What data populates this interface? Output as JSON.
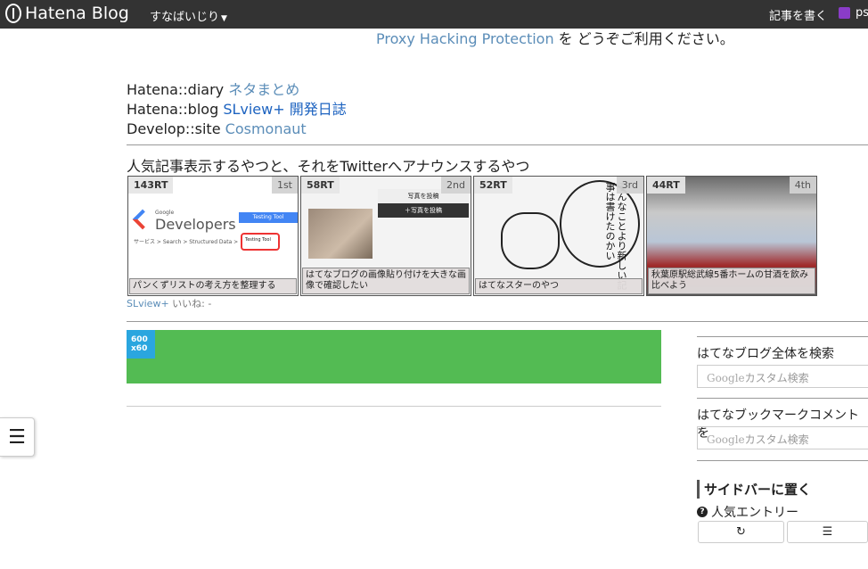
{
  "topbar": {
    "brand": "Hatena Blog",
    "blog_menu": "すなばいじり",
    "write": "記事を書く",
    "user": "ps"
  },
  "notice": {
    "link": "Proxy Hacking Protection",
    "text": " を どうぞご利用ください。"
  },
  "links": [
    {
      "prefix": "Hatena::diary ",
      "link": "ネタまとめ"
    },
    {
      "prefix": "Hatena::blog ",
      "link": "SLview+ 開発日誌"
    },
    {
      "prefix": "Develop::site ",
      "link": "Cosmonaut"
    }
  ],
  "section_title": "人気記事表示するやつと、それをTwitterへアナウンスするやつ",
  "cards": [
    {
      "rt": "143RT",
      "rank": "1st",
      "caption": "パンくずリストの考え方を整理する",
      "thumb_texts": [
        "Google",
        "Developers",
        "Testing Tool",
        "サービス  >  Search  >  Structured Data  >",
        "Testing Tool"
      ]
    },
    {
      "rt": "58RT",
      "rank": "2nd",
      "caption": "はてなブログの画像貼り付けを大きな画像で確認したい",
      "thumb_texts": [
        "写真を投稿",
        "＋写真を投稿"
      ]
    },
    {
      "rt": "52RT",
      "rank": "3rd",
      "caption": "はてなスターのやつ",
      "thumb_texts": [
        "そんなことより新しい記事は書けたのかい"
      ]
    },
    {
      "rt": "44RT",
      "rank": "4th",
      "caption": "秋葉原駅総武線5番ホームの甘酒を飲み比べよう",
      "thumb_texts": []
    }
  ],
  "sl_footer": {
    "link": "SLview+",
    "likes": " いいね: -"
  },
  "ad": {
    "tag_line1": "600",
    "tag_line2": "x60"
  },
  "sidebar": {
    "search_all_title": "はてなブログ全体を検索",
    "search_bookmark_title": "はてなブックマークコメントを",
    "search_placeholder_brand": "Google",
    "search_placeholder_text": "カスタム検索",
    "place_heading": "サイドバーに置く",
    "popular_label": "人気エントリー"
  },
  "icons": [
    "hatena-logo-icon",
    "caret-down-icon",
    "user-avatar-icon",
    "hamburger-menu-icon",
    "question-icon",
    "refresh-icon",
    "list-icon"
  ],
  "colors": {
    "topbar": "#333333",
    "link": "#5b8db8",
    "ad_green": "#53bb53",
    "ad_tag": "#2aa6df"
  }
}
